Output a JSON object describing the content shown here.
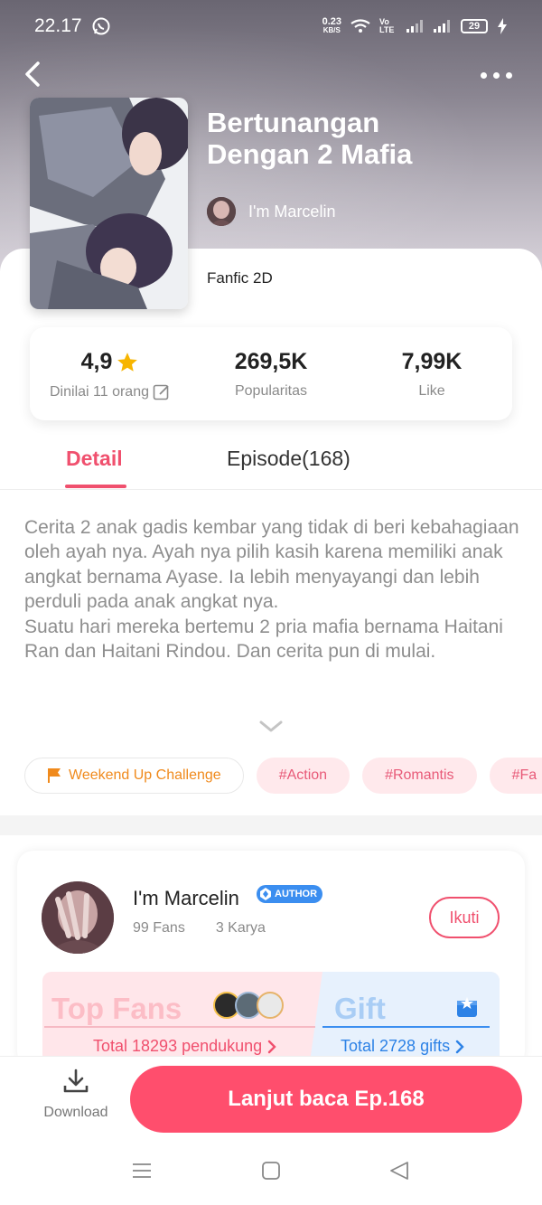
{
  "status_bar": {
    "time": "22.17",
    "speed_value": "0.23",
    "speed_unit": "KB/S",
    "network_label": "Vo LTE",
    "battery": "29"
  },
  "story": {
    "title_line1": "Bertunangan",
    "title_line2": "Dengan 2 Mafia",
    "author": "I'm Marcelin",
    "genre": "Fanfic 2D"
  },
  "stats": {
    "rating_value": "4,9",
    "rating_label": "Dinilai 11 orang",
    "popularity_value": "269,5K",
    "popularity_label": "Popularitas",
    "like_value": "7,99K",
    "like_label": "Like"
  },
  "tabs": {
    "detail": "Detail",
    "episode": "Episode(168)"
  },
  "synopsis": {
    "paragraph1": "Cerita 2 anak gadis kembar yang tidak di beri kebahagiaan oleh ayah nya. Ayah nya pilih kasih karena memiliki anak angkat bernama Ayase. Ia lebih menyayangi dan lebih perduli pada anak angkat nya.",
    "paragraph2": "Suatu hari mereka bertemu 2 pria mafia bernama Haitani Ran dan Haitani Rindou. Dan cerita pun di mulai."
  },
  "tags": {
    "challenge": "Weekend Up Challenge",
    "items": [
      "#Action",
      "#Romantis",
      "#Fa"
    ]
  },
  "author_card": {
    "name": "I'm Marcelin",
    "badge": "AUTHOR",
    "fans": "99 Fans",
    "works": "3 Karya",
    "follow": "Ikuti",
    "top_fans_title": "Top Fans",
    "top_fans_total": "Total 18293 pendukung",
    "gift_title": "Gift",
    "gift_total": "Total 2728 gifts"
  },
  "bottom_bar": {
    "download": "Download",
    "read_button": "Lanjut baca Ep.168"
  },
  "colors": {
    "accent": "#f0506e",
    "read_button": "#ff4e6d",
    "tag_bg": "#ffe9ec",
    "challenge_text": "#f08a1c",
    "gift_blue": "#2d82e6"
  }
}
